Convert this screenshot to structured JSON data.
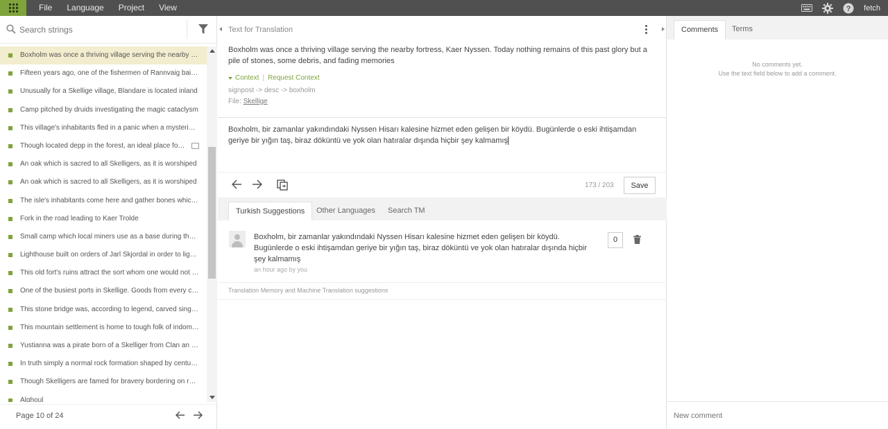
{
  "topbar": {
    "menu": [
      "File",
      "Language",
      "Project",
      "View"
    ],
    "user": "fetch"
  },
  "left": {
    "search_placeholder": "Search strings",
    "items": [
      "Boxholm was once a thriving village serving the nearby fortress, Kaer Nyssen. Today nothing remains of this past glory",
      "Fifteen years ago, one of the fishermen of Rannvaig baited a trap",
      "Unusually for a Skellige village, Blandare is located inland",
      "Camp pitched by druids investigating the magic cataclysm",
      "This village's inhabitants fled in a panic when a mysterious force",
      "Though located depp in the forest, an ideal place for travelers",
      "An oak which is sacred to all Skelligers, as it is worshiped",
      "An oak which is sacred to all Skelligers, as it is worshiped",
      "The isle's inhabitants come here and gather bones which wash ashore",
      "Fork in the road leading to Kaer Trolde",
      "Small camp which local miners use as a base during the season",
      "Lighthouse built on orders of Jarl Skjordal in order to light the way",
      "This old fort's ruins attract the sort whom one would not like to meet",
      "One of the busiest ports in Skellige. Goods from every corner",
      "This stone bridge was, according to legend, carved single-handedly",
      "This mountain settlement is home to tough folk of indomitable spirit",
      "Yustianna was a pirate born of a Skelliger from Clan an Craite",
      "In truth simply a normal rock formation shaped by centuries of wind",
      "Though Skelligers are famed for bravery bordering on recklessness",
      "Alghoul"
    ],
    "pager": "Page 10 of 24"
  },
  "middle": {
    "header_title": "Text for Translation",
    "source_text": "Boxholm was once a thriving village serving the nearby fortress, Kaer Nyssen. Today nothing remains of this past glory but a pile of stones, some debris, and fading memories",
    "context_label": "Context",
    "request_context": "Request Context",
    "path": "signpost -> desc -> boxholm",
    "file_label": "File:",
    "file_name": "Skellige",
    "translation": "Boxholm, bir zamanlar yakındındaki Nyssen Hisarı kalesine hizmet eden gelişen bir köydü. Bugünlerde o eski ihtişamdan geriye bir yığın taş, biraz döküntü ve yok olan hatıralar dışında hiçbir şey kalmamış",
    "counter": "173 / 203",
    "save_label": "Save",
    "tabs": [
      "Turkish Suggestions",
      "Other Languages",
      "Search TM"
    ],
    "suggestion": {
      "text": "Boxholm, bir zamanlar yakındındaki Nyssen Hisarı kalesine hizmet eden gelişen bir köydü. Bugünlerde o eski ihtişamdan geriye bir yığın taş, biraz döküntü ve yok olan hatıralar dışında hiçbir şey kalmamış",
      "meta": "an hour ago by you",
      "votes": "0"
    },
    "tm_note": "Translation Memory and Machine Translation suggestions"
  },
  "right": {
    "tabs": [
      "Comments",
      "Terms"
    ],
    "no_comments_line1": "No comments yet.",
    "no_comments_line2": "Use the text field below to add a comment.",
    "new_comment_placeholder": "New comment"
  },
  "colors": {
    "accent": "#7fa43c",
    "topbar": "#505050",
    "active_row": "#f3edcf"
  },
  "icons": [
    "apps-grid-icon",
    "keyboard-icon",
    "gear-icon",
    "help-icon",
    "search-icon",
    "filter-icon",
    "arrow-left-icon",
    "arrow-right-icon",
    "copy-icon",
    "trash-icon",
    "avatar-icon",
    "comment-icon",
    "kebab-menu-icon"
  ]
}
